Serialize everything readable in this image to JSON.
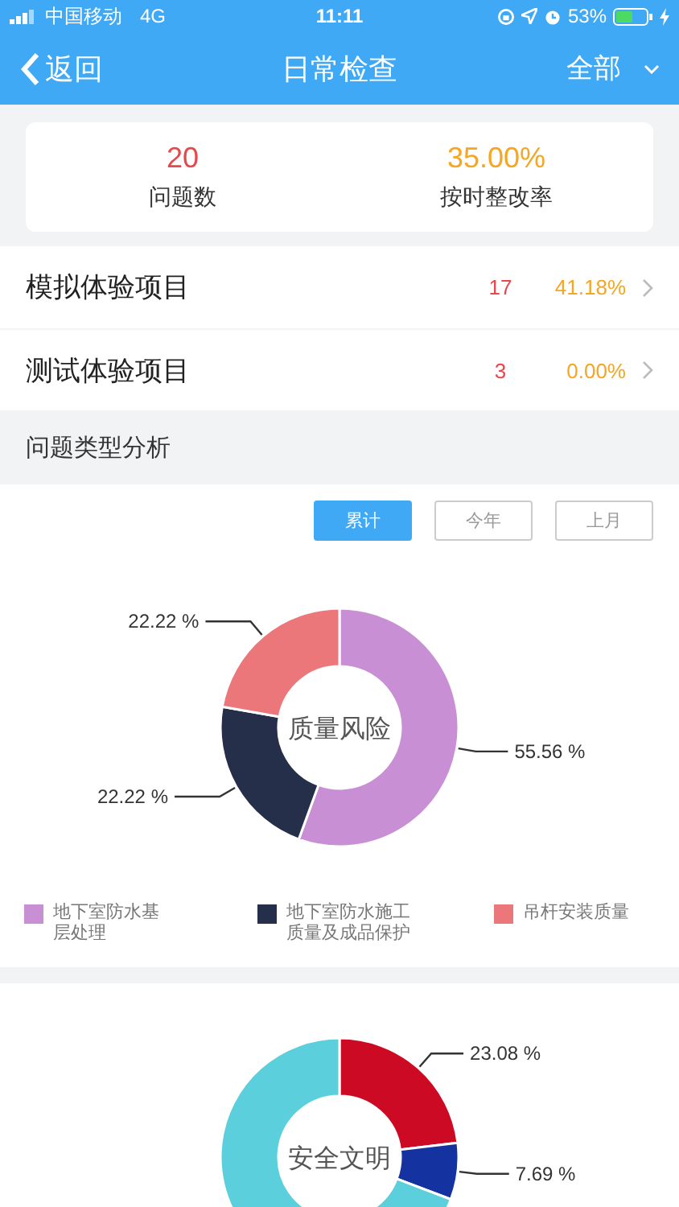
{
  "status_bar": {
    "carrier": "中国移动",
    "network": "4G",
    "time": "11:11",
    "battery": "53%"
  },
  "nav": {
    "back": "返回",
    "title": "日常检查",
    "filter": "全部"
  },
  "summary": [
    {
      "kind": "count",
      "value": "20",
      "label": "问题数"
    },
    {
      "kind": "rate",
      "value": "35.00%",
      "label": "按时整改率"
    }
  ],
  "projects": [
    {
      "name": "模拟体验项目",
      "count": "17",
      "rate": "41.18%"
    },
    {
      "name": "测试体验项目",
      "count": "3",
      "rate": "0.00%"
    }
  ],
  "analysis": {
    "title": "问题类型分析",
    "filters": [
      {
        "label": "累计",
        "selected": true
      },
      {
        "label": "今年",
        "selected": false
      },
      {
        "label": "上月",
        "selected": false
      }
    ],
    "charts": [
      {
        "chart_data": {
          "type": "donut",
          "title": "质量风险",
          "categories": [
            "地下室防水基层处理",
            "地下室防水施工质量及成品保护",
            "吊杆安装质量"
          ],
          "values": [
            55.56,
            22.22,
            22.22
          ],
          "colors": [
            "#c98fd4",
            "#252f4a",
            "#ec777b"
          ],
          "value_labels": [
            "55.56 %",
            "22.22 %",
            "22.22 %"
          ]
        }
      },
      {
        "chart_data": {
          "type": "donut",
          "title": "安全文明",
          "values": [
            23.08,
            7.69,
            69.23
          ],
          "colors": [
            "#cc0a24",
            "#1533a0",
            "#5bd0dc"
          ],
          "value_labels": [
            "23.08 %",
            "7.69 %",
            null
          ]
        }
      }
    ]
  }
}
